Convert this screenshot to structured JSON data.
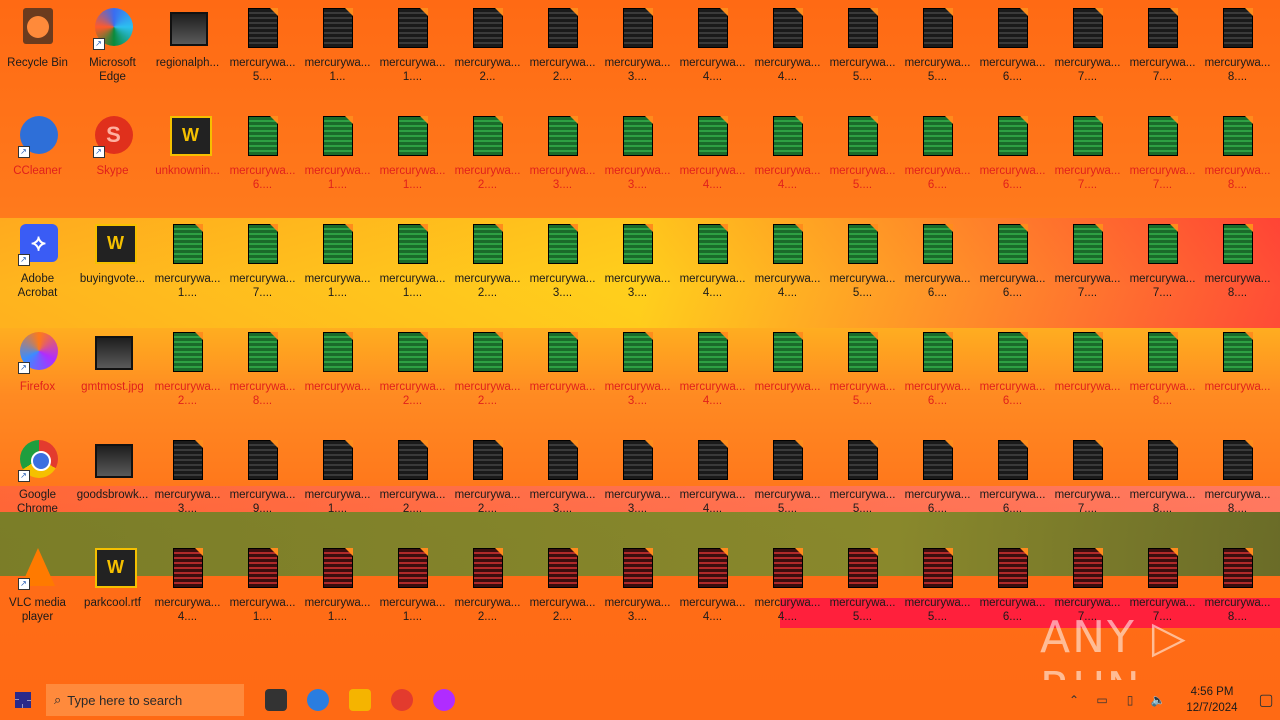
{
  "desktop": {
    "row1": [
      {
        "label1": "Recycle Bin",
        "label2": "",
        "icon": "recycle-bin-icon",
        "kind": "bin"
      },
      {
        "label1": "Microsoft",
        "label2": "Edge",
        "icon": "edge-icon",
        "kind": "edge",
        "shortcut": true
      },
      {
        "label1": "regionalph...",
        "label2": "",
        "icon": "image-file-icon",
        "kind": "img"
      },
      {
        "label1": "mercurywa...",
        "label2": "5....",
        "kind": "doc"
      },
      {
        "label1": "mercurywa...",
        "label2": "1...",
        "kind": "doc"
      },
      {
        "label1": "mercurywa...",
        "label2": "1....",
        "kind": "doc"
      },
      {
        "label1": "mercurywa...",
        "label2": "2...",
        "kind": "doc"
      },
      {
        "label1": "mercurywa...",
        "label2": "2....",
        "kind": "doc"
      },
      {
        "label1": "mercurywa...",
        "label2": "3....",
        "kind": "doc"
      },
      {
        "label1": "mercurywa...",
        "label2": "4....",
        "kind": "doc"
      },
      {
        "label1": "mercurywa...",
        "label2": "4....",
        "kind": "doc"
      },
      {
        "label1": "mercurywa...",
        "label2": "5....",
        "kind": "doc"
      },
      {
        "label1": "mercurywa...",
        "label2": "5....",
        "kind": "doc"
      },
      {
        "label1": "mercurywa...",
        "label2": "6....",
        "kind": "doc"
      },
      {
        "label1": "mercurywa...",
        "label2": "7....",
        "kind": "doc"
      },
      {
        "label1": "mercurywa...",
        "label2": "7....",
        "kind": "doc"
      },
      {
        "label1": "mercurywa...",
        "label2": "8....",
        "kind": "doc"
      }
    ],
    "row2": [
      {
        "label1": "CCleaner",
        "label2": "",
        "icon": "ccleaner-icon",
        "kind": "ccleaner",
        "shortcut": true,
        "red": true
      },
      {
        "label1": "Skype",
        "label2": "",
        "icon": "skype-icon",
        "kind": "skype",
        "shortcut": true,
        "red": true
      },
      {
        "label1": "unknownin...",
        "label2": "",
        "icon": "word-doc-icon",
        "kind": "word",
        "red": true
      },
      {
        "label1": "mercurywa...",
        "label2": "6....",
        "kind": "doc green",
        "red": true
      },
      {
        "label1": "mercurywa...",
        "label2": "1....",
        "kind": "doc green",
        "red": true
      },
      {
        "label1": "mercurywa...",
        "label2": "1....",
        "kind": "doc green",
        "red": true
      },
      {
        "label1": "mercurywa...",
        "label2": "2....",
        "kind": "doc green",
        "red": true
      },
      {
        "label1": "mercurywa...",
        "label2": "3....",
        "kind": "doc green",
        "red": true
      },
      {
        "label1": "mercurywa...",
        "label2": "3....",
        "kind": "doc green",
        "red": true
      },
      {
        "label1": "mercurywa...",
        "label2": "4....",
        "kind": "doc green",
        "red": true
      },
      {
        "label1": "mercurywa...",
        "label2": "4....",
        "kind": "doc green",
        "red": true
      },
      {
        "label1": "mercurywa...",
        "label2": "5....",
        "kind": "doc green",
        "red": true
      },
      {
        "label1": "mercurywa...",
        "label2": "6....",
        "kind": "doc green",
        "red": true
      },
      {
        "label1": "mercurywa...",
        "label2": "6....",
        "kind": "doc green",
        "red": true
      },
      {
        "label1": "mercurywa...",
        "label2": "7....",
        "kind": "doc green",
        "red": true
      },
      {
        "label1": "mercurywa...",
        "label2": "7....",
        "kind": "doc green",
        "red": true
      },
      {
        "label1": "mercurywa...",
        "label2": "8....",
        "kind": "doc green",
        "red": true
      }
    ],
    "row3": [
      {
        "label1": "Adobe",
        "label2": "Acrobat",
        "icon": "acrobat-icon",
        "kind": "acrobat",
        "shortcut": true
      },
      {
        "label1": "buyingvote...",
        "label2": "",
        "icon": "word-doc-icon",
        "kind": "word"
      },
      {
        "label1": "mercurywa...",
        "label2": "1....",
        "kind": "doc green"
      },
      {
        "label1": "mercurywa...",
        "label2": "7....",
        "kind": "doc green"
      },
      {
        "label1": "mercurywa...",
        "label2": "1....",
        "kind": "doc green"
      },
      {
        "label1": "mercurywa...",
        "label2": "1....",
        "kind": "doc green"
      },
      {
        "label1": "mercurywa...",
        "label2": "2....",
        "kind": "doc green"
      },
      {
        "label1": "mercurywa...",
        "label2": "3....",
        "kind": "doc green"
      },
      {
        "label1": "mercurywa...",
        "label2": "3....",
        "kind": "doc green"
      },
      {
        "label1": "mercurywa...",
        "label2": "4....",
        "kind": "doc green"
      },
      {
        "label1": "mercurywa...",
        "label2": "4....",
        "kind": "doc green"
      },
      {
        "label1": "mercurywa...",
        "label2": "5....",
        "kind": "doc green"
      },
      {
        "label1": "mercurywa...",
        "label2": "6....",
        "kind": "doc green"
      },
      {
        "label1": "mercurywa...",
        "label2": "6....",
        "kind": "doc green"
      },
      {
        "label1": "mercurywa...",
        "label2": "7....",
        "kind": "doc green"
      },
      {
        "label1": "mercurywa...",
        "label2": "7....",
        "kind": "doc green"
      },
      {
        "label1": "mercurywa...",
        "label2": "8....",
        "kind": "doc green"
      }
    ],
    "row4": [
      {
        "label1": "Firefox",
        "label2": "",
        "icon": "firefox-icon",
        "kind": "firefox",
        "shortcut": true,
        "red": true
      },
      {
        "label1": "gmtmost.jpg",
        "label2": "",
        "icon": "image-file-icon",
        "kind": "img",
        "red": true
      },
      {
        "label1": "mercurywa...",
        "label2": "2....",
        "kind": "doc green",
        "red": true
      },
      {
        "label1": "mercurywa...",
        "label2": "8....",
        "kind": "doc green",
        "red": true
      },
      {
        "label1": "mercurywa...",
        "label2": "",
        "kind": "doc green",
        "red": true
      },
      {
        "label1": "mercurywa...",
        "label2": "2....",
        "kind": "doc green",
        "red": true
      },
      {
        "label1": "mercurywa...",
        "label2": "2....",
        "kind": "doc green",
        "red": true
      },
      {
        "label1": "mercurywa...",
        "label2": "",
        "kind": "doc green",
        "red": true
      },
      {
        "label1": "mercurywa...",
        "label2": "3....",
        "kind": "doc green",
        "red": true
      },
      {
        "label1": "mercurywa...",
        "label2": "4....",
        "kind": "doc green",
        "red": true
      },
      {
        "label1": "mercurywa...",
        "label2": "",
        "kind": "doc green",
        "red": true
      },
      {
        "label1": "mercurywa...",
        "label2": "5....",
        "kind": "doc green",
        "red": true
      },
      {
        "label1": "mercurywa...",
        "label2": "6....",
        "kind": "doc green",
        "red": true
      },
      {
        "label1": "mercurywa...",
        "label2": "6....",
        "kind": "doc green",
        "red": true
      },
      {
        "label1": "mercurywa...",
        "label2": "",
        "kind": "doc green",
        "red": true
      },
      {
        "label1": "mercurywa...",
        "label2": "8....",
        "kind": "doc green",
        "red": true
      },
      {
        "label1": "mercurywa...",
        "label2": "",
        "kind": "doc green",
        "red": true
      }
    ],
    "row5": [
      {
        "label1": "Google",
        "label2": "Chrome",
        "icon": "chrome-icon",
        "kind": "chrome",
        "shortcut": true
      },
      {
        "label1": "goodsbrowk...",
        "label2": "",
        "icon": "image-file-icon",
        "kind": "img"
      },
      {
        "label1": "mercurywa...",
        "label2": "3....",
        "kind": "doc"
      },
      {
        "label1": "mercurywa...",
        "label2": "9....",
        "kind": "doc"
      },
      {
        "label1": "mercurywa...",
        "label2": "1....",
        "kind": "doc"
      },
      {
        "label1": "mercurywa...",
        "label2": "2....",
        "kind": "doc"
      },
      {
        "label1": "mercurywa...",
        "label2": "2....",
        "kind": "doc"
      },
      {
        "label1": "mercurywa...",
        "label2": "3....",
        "kind": "doc"
      },
      {
        "label1": "mercurywa...",
        "label2": "3....",
        "kind": "doc"
      },
      {
        "label1": "mercurywa...",
        "label2": "4....",
        "kind": "doc"
      },
      {
        "label1": "mercurywa...",
        "label2": "5....",
        "kind": "doc"
      },
      {
        "label1": "mercurywa...",
        "label2": "5....",
        "kind": "doc"
      },
      {
        "label1": "mercurywa...",
        "label2": "6....",
        "kind": "doc"
      },
      {
        "label1": "mercurywa...",
        "label2": "6....",
        "kind": "doc"
      },
      {
        "label1": "mercurywa...",
        "label2": "7....",
        "kind": "doc"
      },
      {
        "label1": "mercurywa...",
        "label2": "8....",
        "kind": "doc"
      },
      {
        "label1": "mercurywa...",
        "label2": "8....",
        "kind": "doc"
      }
    ],
    "row6": [
      {
        "label1": "VLC media",
        "label2": "player",
        "icon": "vlc-icon",
        "kind": "vlc",
        "shortcut": true
      },
      {
        "label1": "parkcool.rtf",
        "label2": "",
        "icon": "word-doc-icon",
        "kind": "word"
      },
      {
        "label1": "mercurywa...",
        "label2": "4....",
        "kind": "doc red"
      },
      {
        "label1": "mercurywa...",
        "label2": "1....",
        "kind": "doc red"
      },
      {
        "label1": "mercurywa...",
        "label2": "1....",
        "kind": "doc red"
      },
      {
        "label1": "mercurywa...",
        "label2": "1....",
        "kind": "doc red"
      },
      {
        "label1": "mercurywa...",
        "label2": "2....",
        "kind": "doc red"
      },
      {
        "label1": "mercurywa...",
        "label2": "2....",
        "kind": "doc red"
      },
      {
        "label1": "mercurywa...",
        "label2": "3....",
        "kind": "doc red"
      },
      {
        "label1": "mercurywa...",
        "label2": "4....",
        "kind": "doc red"
      },
      {
        "label1": "mercurywa...",
        "label2": "4....",
        "kind": "doc red"
      },
      {
        "label1": "mercurywa...",
        "label2": "5....",
        "kind": "doc red"
      },
      {
        "label1": "mercurywa...",
        "label2": "5....",
        "kind": "doc red"
      },
      {
        "label1": "mercurywa...",
        "label2": "6....",
        "kind": "doc red"
      },
      {
        "label1": "mercurywa...",
        "label2": "7....",
        "kind": "doc red"
      },
      {
        "label1": "mercurywa...",
        "label2": "7....",
        "kind": "doc red"
      },
      {
        "label1": "mercurywa...",
        "label2": "8....",
        "kind": "doc red"
      }
    ]
  },
  "watermark": "ANY ▷ RUN",
  "taskbar": {
    "search_placeholder": "Type here to search",
    "pinned": [
      {
        "icon": "task-view-icon",
        "color": "#333333"
      },
      {
        "icon": "edge-icon",
        "color": "#2a7de0"
      },
      {
        "icon": "file-explorer-icon",
        "color": "#f5b400"
      },
      {
        "icon": "chrome-icon",
        "color": "#e33b2e"
      },
      {
        "icon": "firefox-icon",
        "color": "#b02cff"
      }
    ],
    "clock_time": "4:56 PM",
    "clock_date": "12/7/2024"
  },
  "colors": {
    "desktop_accent": "#ff6a14",
    "red_label": "#e0201c"
  }
}
